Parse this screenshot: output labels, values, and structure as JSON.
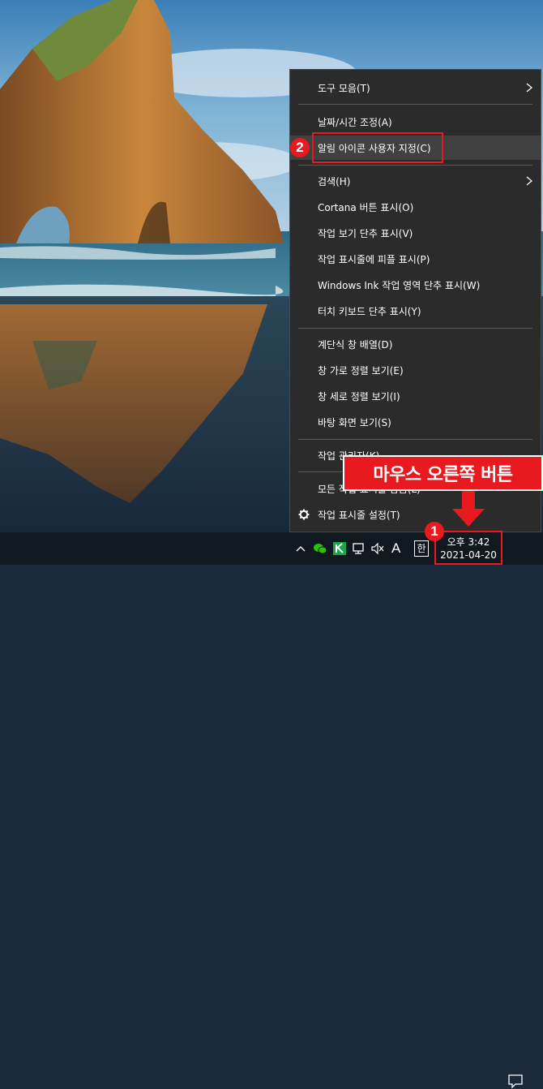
{
  "context_menu": {
    "items": [
      {
        "label": "도구 모음(T)",
        "submenu": true
      },
      {
        "label": "날짜/시간 조정(A)"
      },
      {
        "label": "알림 아이콘 사용자 지정(C)"
      },
      {
        "label": "검색(H)",
        "submenu": true
      },
      {
        "label": "Cortana 버튼 표시(O)"
      },
      {
        "label": "작업 보기 단추 표시(V)"
      },
      {
        "label": "작업 표시줄에 피플 표시(P)"
      },
      {
        "label": "Windows Ink 작업 영역 단추 표시(W)"
      },
      {
        "label": "터치 키보드 단추 표시(Y)"
      },
      {
        "label": "계단식 창 배열(D)"
      },
      {
        "label": "창 가로 정렬 보기(E)"
      },
      {
        "label": "창 세로 정렬 보기(I)"
      },
      {
        "label": "바탕 화면 보기(S)"
      },
      {
        "label": "작업 관리자(K)"
      },
      {
        "label": "모든 작업 표시줄 잠금(L)"
      },
      {
        "label": "작업 표시줄 설정(T)"
      }
    ]
  },
  "annotations": {
    "badge_1": "1",
    "badge_2": "2",
    "callout": "마우스 오른쪽 버튼",
    "accent_color": "#e8191f"
  },
  "taskbar": {
    "ime_mode": "A",
    "ime_lang": "한",
    "clock_time": "오후 3:42",
    "clock_date": "2021-04-20",
    "tray_icons": [
      "chevron-up-icon",
      "wechat-icon",
      "green-app-icon",
      "network-icon",
      "volume-mute-icon",
      "ime-icon",
      "notification-icon"
    ]
  }
}
